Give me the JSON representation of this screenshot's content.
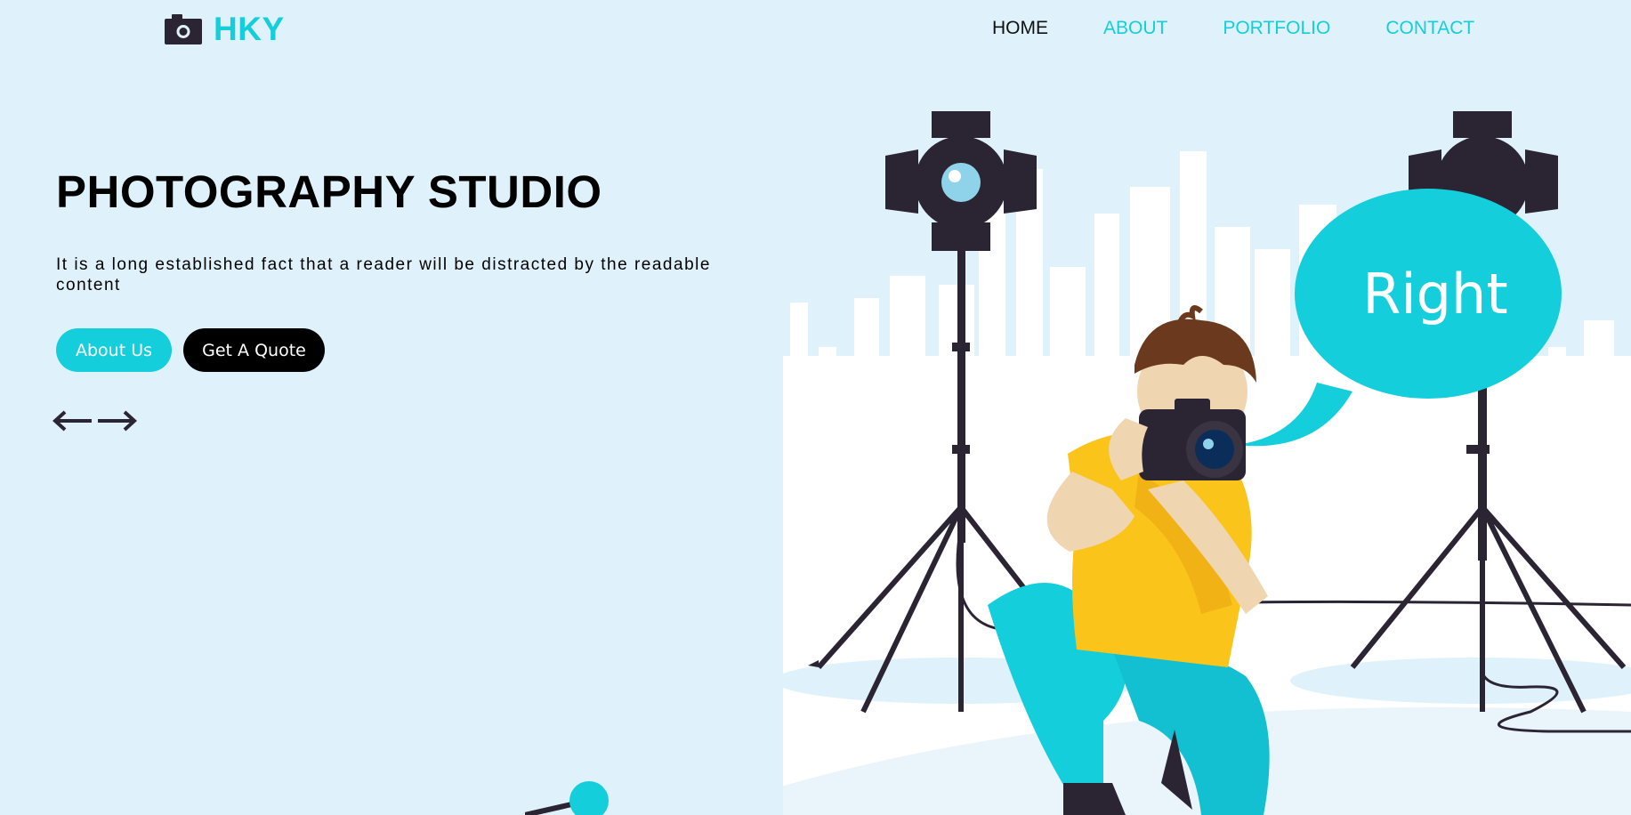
{
  "brand": {
    "name": "HKY",
    "icon": "camera-icon"
  },
  "nav": {
    "items": [
      {
        "label": "HOME",
        "active": true
      },
      {
        "label": "ABOUT",
        "active": false
      },
      {
        "label": "PORTFOLIO",
        "active": false
      },
      {
        "label": "CONTACT",
        "active": false
      }
    ]
  },
  "hero": {
    "title": "PHOTOGRAPHY STUDIO",
    "description": "It is a long established fact that a reader will be distracted by the readable content",
    "buttons": {
      "about": "About Us",
      "quote": "Get A Quote"
    },
    "arrows": {
      "prev_icon": "arrow-left-icon",
      "next_icon": "arrow-right-icon"
    }
  },
  "illustration": {
    "speech_bubble_text": "Right"
  },
  "colors": {
    "accent": "#14cedc",
    "background": "#dff2fb",
    "text_dark": "#000000",
    "shirt": "#fbc41b",
    "stand": "#2b2433"
  }
}
